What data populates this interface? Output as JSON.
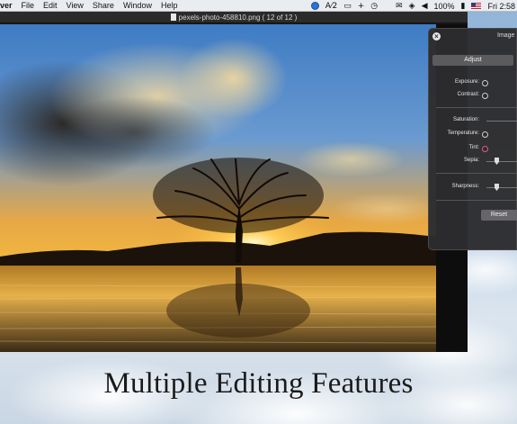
{
  "menubar": {
    "items": [
      "ver",
      "File",
      "Edit",
      "View",
      "Share",
      "Window",
      "Help"
    ],
    "status": {
      "globe_icon": "globe-icon",
      "ai_badge": "A⁄2",
      "display_icon": "display-icon",
      "plus": "+",
      "time_machine_icon": "time-machine-icon",
      "mail_icon": "mail-icon",
      "wifi_icon": "wifi-icon",
      "volume_icon": "volume-icon",
      "battery": "100%",
      "battery_icon": "battery-icon",
      "flag_icon": "us-flag-icon",
      "clock": "Fri 2:58"
    }
  },
  "viewer": {
    "title": "pexels-photo-458810.png ( 12 of 12 )"
  },
  "panel": {
    "title": "Image",
    "close_label": "×",
    "tab": "Adjust",
    "controls": [
      {
        "label": "Exposure:",
        "type": "knob"
      },
      {
        "label": "Contrast:",
        "type": "knob"
      },
      {
        "label": "Saturation:",
        "type": "slider"
      },
      {
        "label": "Temperature:",
        "type": "knob"
      },
      {
        "label": "Tint:",
        "type": "knob-tint"
      },
      {
        "label": "Sepia:",
        "type": "slider"
      },
      {
        "label": "Sharpness:",
        "type": "slider"
      }
    ],
    "reset_label": "Reset"
  },
  "caption": "Multiple Editing Features",
  "colors": {
    "menubar": "#eceef1",
    "panel_bg": "#2c2c2e",
    "tint_accent": "#e05a8c",
    "caption_text": "#1a1a1a"
  }
}
